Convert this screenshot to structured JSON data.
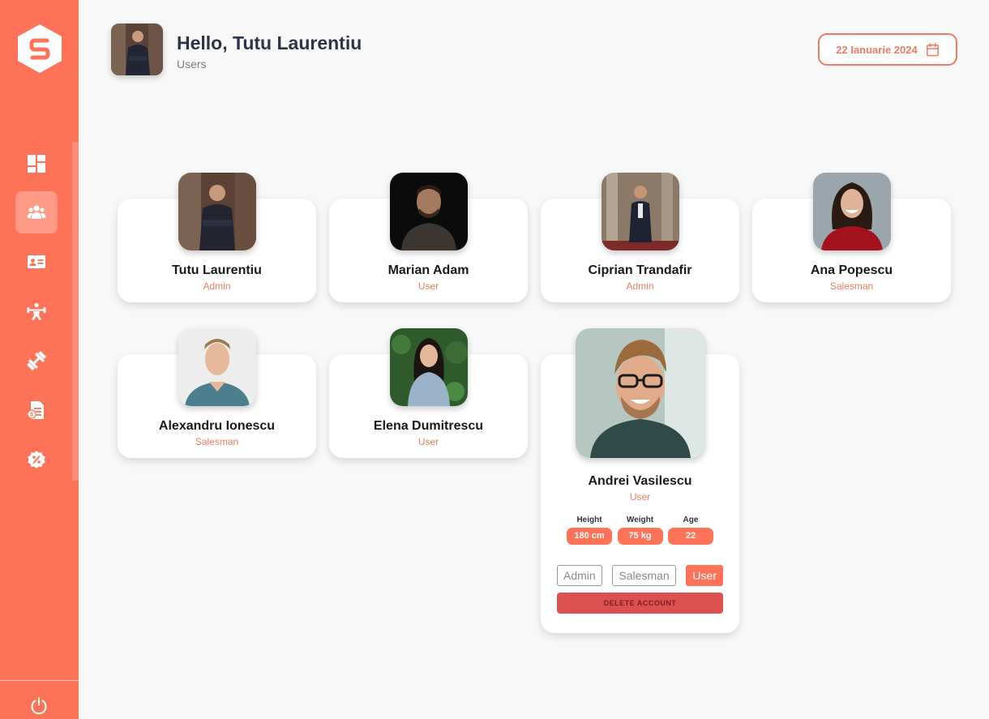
{
  "app": {
    "logo_letter": "S",
    "brand_color": "#fe7358"
  },
  "header": {
    "greeting": "Hello, Tutu Laurentiu",
    "subtitle": "Users",
    "date": "22 Ianuarie 2024"
  },
  "sidebar": {
    "items": [
      {
        "icon": "dashboard-icon"
      },
      {
        "icon": "users-icon",
        "active": true
      },
      {
        "icon": "id-card-icon"
      },
      {
        "icon": "workout-icon"
      },
      {
        "icon": "dumbbell-icon"
      },
      {
        "icon": "invoice-icon"
      },
      {
        "icon": "discount-icon"
      }
    ],
    "logout_icon": "power-icon"
  },
  "users": [
    {
      "name": "Tutu Laurentiu",
      "role": "Admin"
    },
    {
      "name": "Marian Adam",
      "role": "User"
    },
    {
      "name": "Ciprian Trandafir",
      "role": "Admin"
    },
    {
      "name": "Ana Popescu",
      "role": "Salesman"
    },
    {
      "name": "Alexandru Ionescu",
      "role": "Salesman"
    },
    {
      "name": "Elena Dumitrescu",
      "role": "User"
    },
    {
      "name": "Andrei Vasilescu",
      "role": "User",
      "expanded": true,
      "stats": [
        {
          "label": "Height",
          "value": "180 cm"
        },
        {
          "label": "Weight",
          "value": "75 kg"
        },
        {
          "label": "Age",
          "value": "22"
        }
      ],
      "role_options": [
        "Admin",
        "Salesman",
        "User"
      ],
      "selected_role": "User",
      "delete_label": "DELETE ACCOUNT"
    }
  ]
}
